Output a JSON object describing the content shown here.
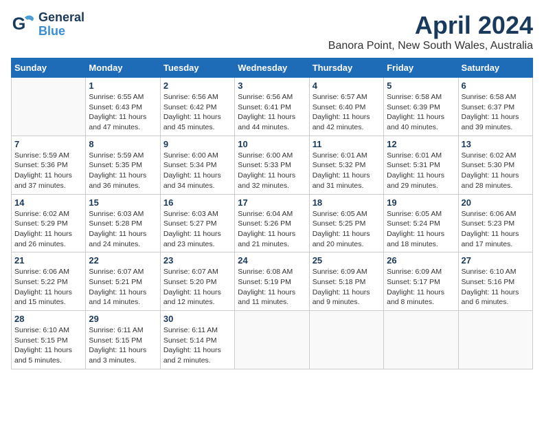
{
  "header": {
    "logo_general": "General",
    "logo_blue": "Blue",
    "title": "April 2024",
    "subtitle": "Banora Point, New South Wales, Australia"
  },
  "days_of_week": [
    "Sunday",
    "Monday",
    "Tuesday",
    "Wednesday",
    "Thursday",
    "Friday",
    "Saturday"
  ],
  "weeks": [
    [
      {
        "day": "",
        "info": ""
      },
      {
        "day": "1",
        "info": "Sunrise: 6:55 AM\nSunset: 6:43 PM\nDaylight: 11 hours\nand 47 minutes."
      },
      {
        "day": "2",
        "info": "Sunrise: 6:56 AM\nSunset: 6:42 PM\nDaylight: 11 hours\nand 45 minutes."
      },
      {
        "day": "3",
        "info": "Sunrise: 6:56 AM\nSunset: 6:41 PM\nDaylight: 11 hours\nand 44 minutes."
      },
      {
        "day": "4",
        "info": "Sunrise: 6:57 AM\nSunset: 6:40 PM\nDaylight: 11 hours\nand 42 minutes."
      },
      {
        "day": "5",
        "info": "Sunrise: 6:58 AM\nSunset: 6:39 PM\nDaylight: 11 hours\nand 40 minutes."
      },
      {
        "day": "6",
        "info": "Sunrise: 6:58 AM\nSunset: 6:37 PM\nDaylight: 11 hours\nand 39 minutes."
      }
    ],
    [
      {
        "day": "7",
        "info": "Sunrise: 5:59 AM\nSunset: 5:36 PM\nDaylight: 11 hours\nand 37 minutes."
      },
      {
        "day": "8",
        "info": "Sunrise: 5:59 AM\nSunset: 5:35 PM\nDaylight: 11 hours\nand 36 minutes."
      },
      {
        "day": "9",
        "info": "Sunrise: 6:00 AM\nSunset: 5:34 PM\nDaylight: 11 hours\nand 34 minutes."
      },
      {
        "day": "10",
        "info": "Sunrise: 6:00 AM\nSunset: 5:33 PM\nDaylight: 11 hours\nand 32 minutes."
      },
      {
        "day": "11",
        "info": "Sunrise: 6:01 AM\nSunset: 5:32 PM\nDaylight: 11 hours\nand 31 minutes."
      },
      {
        "day": "12",
        "info": "Sunrise: 6:01 AM\nSunset: 5:31 PM\nDaylight: 11 hours\nand 29 minutes."
      },
      {
        "day": "13",
        "info": "Sunrise: 6:02 AM\nSunset: 5:30 PM\nDaylight: 11 hours\nand 28 minutes."
      }
    ],
    [
      {
        "day": "14",
        "info": "Sunrise: 6:02 AM\nSunset: 5:29 PM\nDaylight: 11 hours\nand 26 minutes."
      },
      {
        "day": "15",
        "info": "Sunrise: 6:03 AM\nSunset: 5:28 PM\nDaylight: 11 hours\nand 24 minutes."
      },
      {
        "day": "16",
        "info": "Sunrise: 6:03 AM\nSunset: 5:27 PM\nDaylight: 11 hours\nand 23 minutes."
      },
      {
        "day": "17",
        "info": "Sunrise: 6:04 AM\nSunset: 5:26 PM\nDaylight: 11 hours\nand 21 minutes."
      },
      {
        "day": "18",
        "info": "Sunrise: 6:05 AM\nSunset: 5:25 PM\nDaylight: 11 hours\nand 20 minutes."
      },
      {
        "day": "19",
        "info": "Sunrise: 6:05 AM\nSunset: 5:24 PM\nDaylight: 11 hours\nand 18 minutes."
      },
      {
        "day": "20",
        "info": "Sunrise: 6:06 AM\nSunset: 5:23 PM\nDaylight: 11 hours\nand 17 minutes."
      }
    ],
    [
      {
        "day": "21",
        "info": "Sunrise: 6:06 AM\nSunset: 5:22 PM\nDaylight: 11 hours\nand 15 minutes."
      },
      {
        "day": "22",
        "info": "Sunrise: 6:07 AM\nSunset: 5:21 PM\nDaylight: 11 hours\nand 14 minutes."
      },
      {
        "day": "23",
        "info": "Sunrise: 6:07 AM\nSunset: 5:20 PM\nDaylight: 11 hours\nand 12 minutes."
      },
      {
        "day": "24",
        "info": "Sunrise: 6:08 AM\nSunset: 5:19 PM\nDaylight: 11 hours\nand 11 minutes."
      },
      {
        "day": "25",
        "info": "Sunrise: 6:09 AM\nSunset: 5:18 PM\nDaylight: 11 hours\nand 9 minutes."
      },
      {
        "day": "26",
        "info": "Sunrise: 6:09 AM\nSunset: 5:17 PM\nDaylight: 11 hours\nand 8 minutes."
      },
      {
        "day": "27",
        "info": "Sunrise: 6:10 AM\nSunset: 5:16 PM\nDaylight: 11 hours\nand 6 minutes."
      }
    ],
    [
      {
        "day": "28",
        "info": "Sunrise: 6:10 AM\nSunset: 5:15 PM\nDaylight: 11 hours\nand 5 minutes."
      },
      {
        "day": "29",
        "info": "Sunrise: 6:11 AM\nSunset: 5:15 PM\nDaylight: 11 hours\nand 3 minutes."
      },
      {
        "day": "30",
        "info": "Sunrise: 6:11 AM\nSunset: 5:14 PM\nDaylight: 11 hours\nand 2 minutes."
      },
      {
        "day": "",
        "info": ""
      },
      {
        "day": "",
        "info": ""
      },
      {
        "day": "",
        "info": ""
      },
      {
        "day": "",
        "info": ""
      }
    ]
  ]
}
